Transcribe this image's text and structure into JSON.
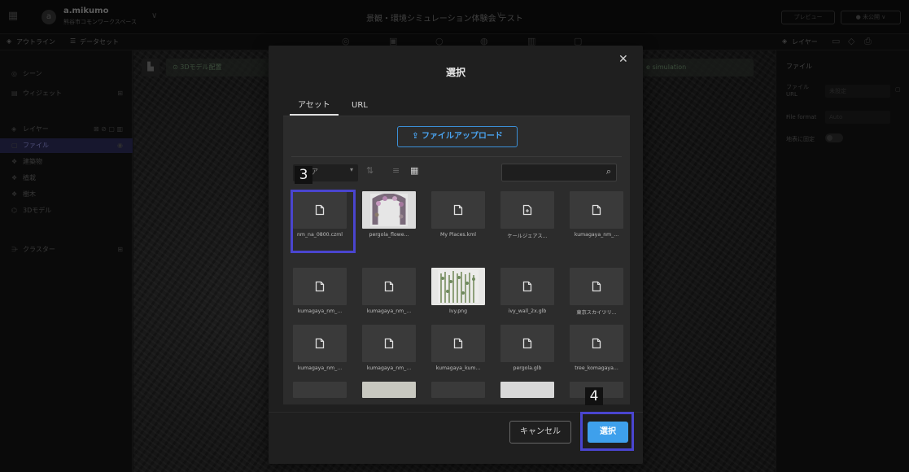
{
  "topbar": {
    "user": "a.mikumo",
    "workspace": "熊谷市コモンワークスペース",
    "project_title": "景観・環境シミュレーション体験会 テスト",
    "preview": "プレビュー",
    "publish": "● 未公開 ∨"
  },
  "subbar": {
    "outline_tab": "アウトライン",
    "dataset_tab": "データセット",
    "layer_tab": "レイヤー"
  },
  "left_panel": {
    "scene": "シーン",
    "widget": "ウィジェット",
    "layer": "レイヤー",
    "items": [
      "ファイル",
      "建築物",
      "植栽",
      "樹木",
      "3Dモデル"
    ],
    "cluster": "クラスター"
  },
  "right_panel": {
    "section": "ファイル",
    "file_url_label": "ファイル URL",
    "file_url_value": "未設定",
    "file_format_label": "File format",
    "file_format_value": "Auto",
    "clamp_label": "地表に固定"
  },
  "viewport": {
    "chip_left": "3Dモデル配置",
    "chip_right": "e simulation"
  },
  "modal": {
    "title": "選択",
    "tabs": [
      "アセット",
      "URL"
    ],
    "upload_label": "ファイルアップロード",
    "sort_value": "ア",
    "files": [
      {
        "name": "nm_na_0800.czml",
        "kind": "file"
      },
      {
        "name": "pergola_flowe...",
        "kind": "flower"
      },
      {
        "name": "My Places.kml",
        "kind": "file"
      },
      {
        "name": "ケールジェアス...",
        "kind": "file2"
      },
      {
        "name": "kumagaya_nm_...",
        "kind": "file"
      },
      {
        "name": "kumagaya_nm_...",
        "kind": "file"
      },
      {
        "name": "kumagaya_nm_...",
        "kind": "file"
      },
      {
        "name": "Ivy.png",
        "kind": "ivy"
      },
      {
        "name": "ivy_wall_2x.glb",
        "kind": "file"
      },
      {
        "name": "東京スカイツリ...",
        "kind": "file"
      },
      {
        "name": "kumagaya_nm_...",
        "kind": "file"
      },
      {
        "name": "kumagaya_nm_...",
        "kind": "file"
      },
      {
        "name": "kumagaya_kum...",
        "kind": "file"
      },
      {
        "name": "pergola.glb",
        "kind": "file"
      },
      {
        "name": "tree_komagaya...",
        "kind": "file"
      }
    ],
    "cancel_label": "キャンセル",
    "select_label": "選択"
  },
  "annotations": {
    "step3": "3",
    "step4": "4"
  }
}
